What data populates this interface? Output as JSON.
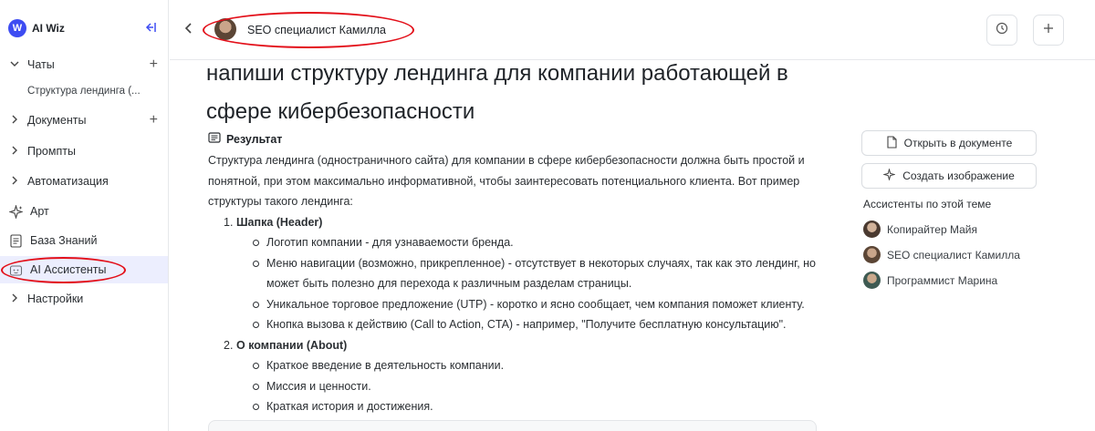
{
  "app": {
    "name": "AI Wiz",
    "logo_letter": "W"
  },
  "sidebar": {
    "items": [
      {
        "label": "Чаты"
      },
      {
        "label": "Документы"
      },
      {
        "label": "Промпты"
      },
      {
        "label": "Автоматизация"
      },
      {
        "label": "Арт"
      },
      {
        "label": "База Знаний"
      },
      {
        "label": "AI Ассистенты"
      },
      {
        "label": "Настройки"
      }
    ],
    "chat_sub_item": "Структура лендинга (..."
  },
  "header": {
    "assistant_name": "SEO специалист Камилла"
  },
  "main": {
    "question": "напиши структуру лендинга для компании работающей в сфере кибербезопасности",
    "result_label": "Результат",
    "intro": "Структура лендинга (одностраничного сайта) для компании в сфере кибербезопасности должна быть простой и понятной, при этом максимально информативной, чтобы заинтересовать потенциального клиента. Вот пример структуры такого лендинга:",
    "sections": [
      {
        "number": "1.",
        "title": "Шапка (Header)",
        "bullets": [
          "Логотип компании - для узнаваемости бренда.",
          "Меню навигации (возможно, прикрепленное) - отсутствует в некоторых случаях, так как это лендинг, но может быть полезно для перехода к различным разделам страницы.",
          "Уникальное торговое предложение (UTP) - коротко и ясно сообщает, чем компания поможет клиенту.",
          "Кнопка вызова к действию (Call to Action, CTA) - например, \"Получите бесплатную консультацию\"."
        ]
      },
      {
        "number": "2.",
        "title": "О компании (About)",
        "bullets": [
          "Краткое введение в деятельность компании.",
          "Миссия и ценности.",
          "Краткая история и достижения."
        ]
      }
    ]
  },
  "right_panel": {
    "open_in_document": "Открыть в документе",
    "create_image": "Создать изображение",
    "assistants_heading": "Ассистенты по этой теме",
    "assistants": [
      {
        "name": "Копирайтер Майя"
      },
      {
        "name": "SEO специалист Камилла"
      },
      {
        "name": "Программист Марина"
      }
    ]
  }
}
